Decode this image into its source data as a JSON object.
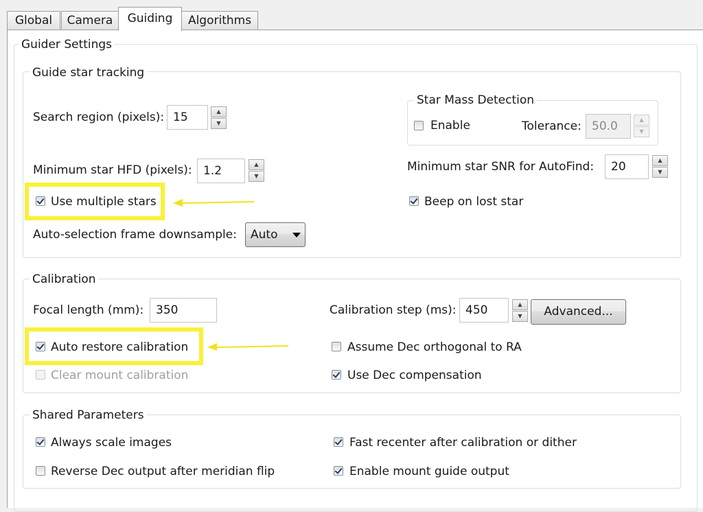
{
  "tabs": [
    "Global",
    "Camera",
    "Guiding",
    "Algorithms"
  ],
  "active_tab": "Guiding",
  "guider_settings": {
    "title": "Guider Settings",
    "tracking": {
      "title": "Guide star tracking",
      "search_region_label": "Search region (pixels):",
      "search_region_value": "15",
      "min_hfd_label": "Minimum star HFD (pixels):",
      "min_hfd_value": "1.2",
      "use_multiple_stars": {
        "label": "Use multiple stars",
        "checked": true
      },
      "downsample_label": "Auto-selection frame downsample:",
      "downsample_value": "Auto",
      "mass_detection": {
        "title": "Star Mass Detection",
        "enable": {
          "label": "Enable",
          "checked": false
        },
        "tolerance_label": "Tolerance:",
        "tolerance_value": "50.0"
      },
      "min_snr_label": "Minimum star SNR for AutoFind:",
      "min_snr_value": "20",
      "beep_lost_star": {
        "label": "Beep on lost star",
        "checked": true
      }
    },
    "calibration": {
      "title": "Calibration",
      "focal_length_label": "Focal length (mm):",
      "focal_length_value": "350",
      "cal_step_label": "Calibration step (ms):",
      "cal_step_value": "450",
      "advanced_button": "Advanced...",
      "auto_restore": {
        "label": "Auto restore calibration",
        "checked": true
      },
      "clear_mount": {
        "label": "Clear mount calibration",
        "checked": false,
        "disabled": true
      },
      "assume_dec_orth": {
        "label": "Assume Dec orthogonal to RA",
        "checked": false
      },
      "use_dec_comp": {
        "label": "Use Dec compensation",
        "checked": true
      }
    },
    "shared": {
      "title": "Shared Parameters",
      "always_scale": {
        "label": "Always scale images",
        "checked": true
      },
      "reverse_dec": {
        "label": "Reverse Dec output after meridian flip",
        "checked": false
      },
      "fast_recenter": {
        "label": "Fast recenter after calibration or dither",
        "checked": true
      },
      "enable_mount_output": {
        "label": "Enable mount guide output",
        "checked": true
      }
    }
  },
  "colors": {
    "highlight": "#fbf03a",
    "arrow": "#f2e21c"
  }
}
